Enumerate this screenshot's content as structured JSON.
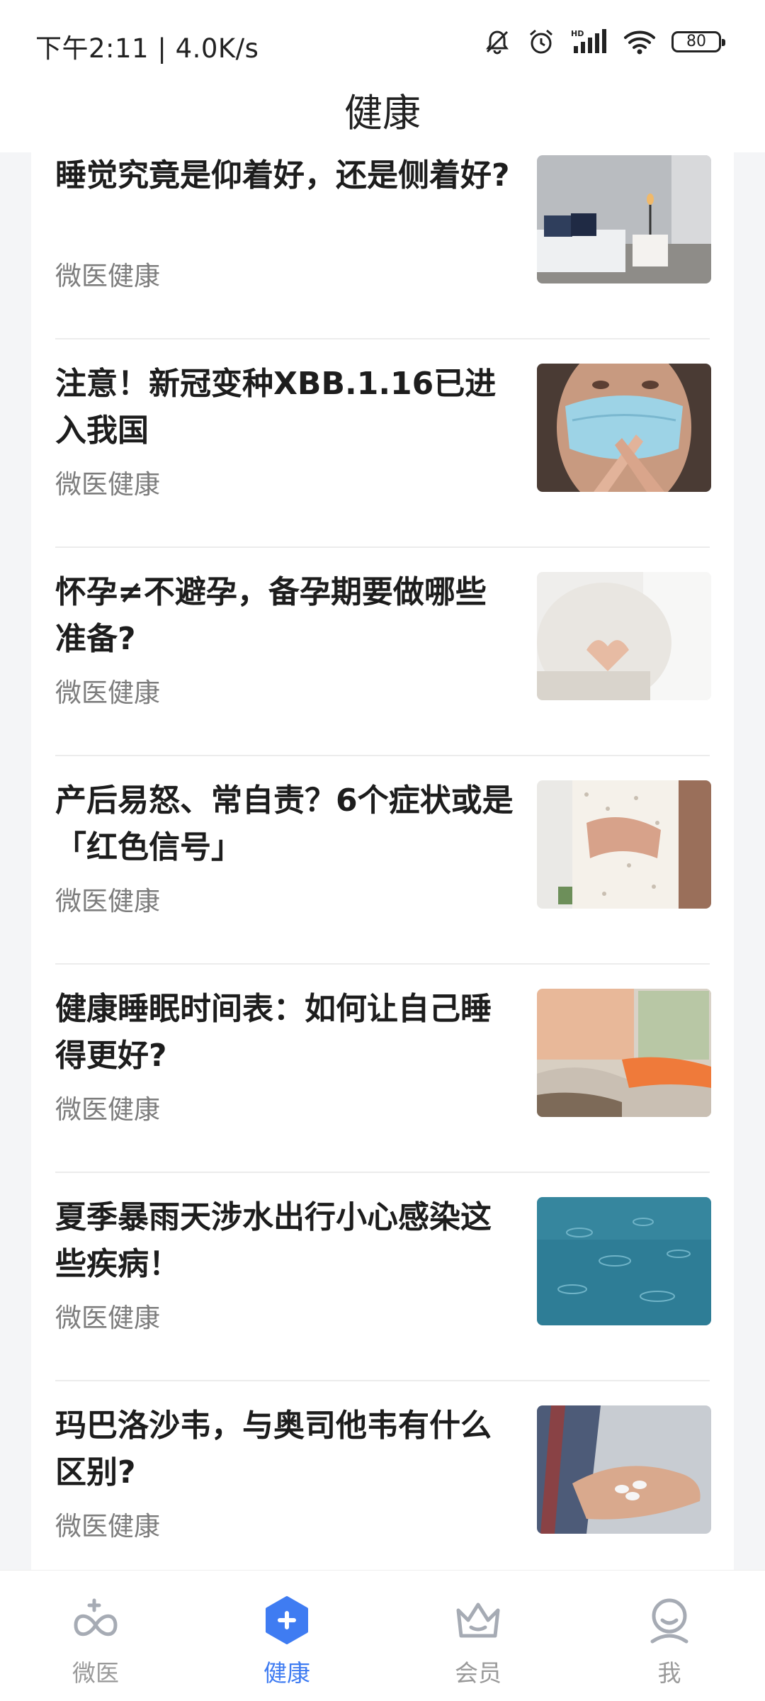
{
  "status_bar": {
    "time_text": "下午2:11 | 4.0K/s",
    "battery_level": "80",
    "icons": [
      "bell-off-icon",
      "alarm-icon",
      "hd-signal-icon",
      "wifi-icon",
      "battery-icon"
    ]
  },
  "header": {
    "title": "健康"
  },
  "articles": [
    {
      "title": "睡觉究竟是仰着好，还是侧着好?",
      "source": "微医健康",
      "thumbnail": "bedroom-photo"
    },
    {
      "title": "注意！新冠变种XBB.1.16已进入我国",
      "source": "微医健康",
      "thumbnail": "masked-person-photo"
    },
    {
      "title": "怀孕≠不避孕，备孕期要做哪些准备?",
      "source": "微医健康",
      "thumbnail": "pregnant-belly-photo"
    },
    {
      "title": "产后易怒、常自责？6个症状或是「红色信号」",
      "source": "微医健康",
      "thumbnail": "couple-hands-belly-photo"
    },
    {
      "title": "健康睡眠时间表：如何让自己睡得更好?",
      "source": "微医健康",
      "thumbnail": "messy-bed-photo"
    },
    {
      "title": "夏季暴雨天涉水出行小心感染这些疾病！",
      "source": "微医健康",
      "thumbnail": "rain-water-photo"
    },
    {
      "title": "玛巴洛沙韦，与奥司他韦有什么区别?",
      "source": "微医健康",
      "thumbnail": "pills-in-hand-photo"
    }
  ],
  "tab_bar": {
    "tabs": [
      {
        "label": "微医",
        "icon": "weiyi-logo-icon",
        "active": false
      },
      {
        "label": "健康",
        "icon": "health-plus-icon",
        "active": true
      },
      {
        "label": "会员",
        "icon": "crown-icon",
        "active": false
      },
      {
        "label": "我",
        "icon": "user-icon",
        "active": false
      }
    ],
    "active_color": "#3f7cf2",
    "inactive_color": "#9a9a9a"
  }
}
